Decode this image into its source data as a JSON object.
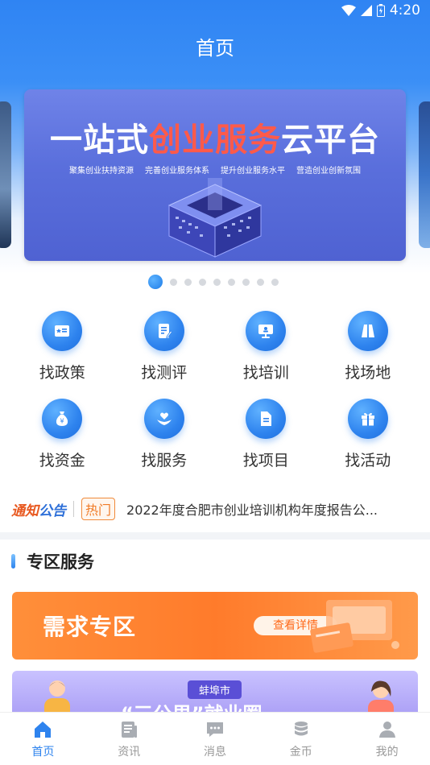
{
  "status": {
    "time": "4:20"
  },
  "header": {
    "title": "首页"
  },
  "banner": {
    "title_pre": "一站式",
    "title_hl": "创业服务",
    "title_post": "云平台",
    "subtitles": [
      "聚集创业扶持资源",
      "完善创业服务体系",
      "提升创业服务水平",
      "营造创业创新氛围"
    ],
    "dot_count": 9,
    "active_dot": 1
  },
  "services": [
    {
      "label": "找政策",
      "icon": "policy-icon"
    },
    {
      "label": "找测评",
      "icon": "assessment-icon"
    },
    {
      "label": "找培训",
      "icon": "training-icon"
    },
    {
      "label": "找场地",
      "icon": "venue-icon"
    },
    {
      "label": "找资金",
      "icon": "money-bag-icon"
    },
    {
      "label": "找服务",
      "icon": "service-hand-heart-icon"
    },
    {
      "label": "找项目",
      "icon": "project-document-icon"
    },
    {
      "label": "找活动",
      "icon": "gift-icon"
    }
  ],
  "notice": {
    "logo_a": "通知",
    "logo_b": "公告",
    "tag": "热门",
    "text": "2022年度合肥市创业培训机构年度报告公..."
  },
  "zone": {
    "title": "专区服务",
    "card1": {
      "title": "需求专区",
      "button": "查看详情"
    },
    "card2": {
      "city": "蚌埠市",
      "text": "“三公里”就业圈"
    }
  },
  "tabbar": [
    {
      "label": "首页",
      "icon": "home-icon",
      "active": true
    },
    {
      "label": "资讯",
      "icon": "news-icon",
      "active": false
    },
    {
      "label": "消息",
      "icon": "message-icon",
      "active": false
    },
    {
      "label": "金币",
      "icon": "coins-icon",
      "active": false
    },
    {
      "label": "我的",
      "icon": "profile-icon",
      "active": false
    }
  ],
  "colors": {
    "primary": "#2e83ee",
    "orange": "#ff7b2b",
    "banner_highlight": "#ff5a4a"
  }
}
